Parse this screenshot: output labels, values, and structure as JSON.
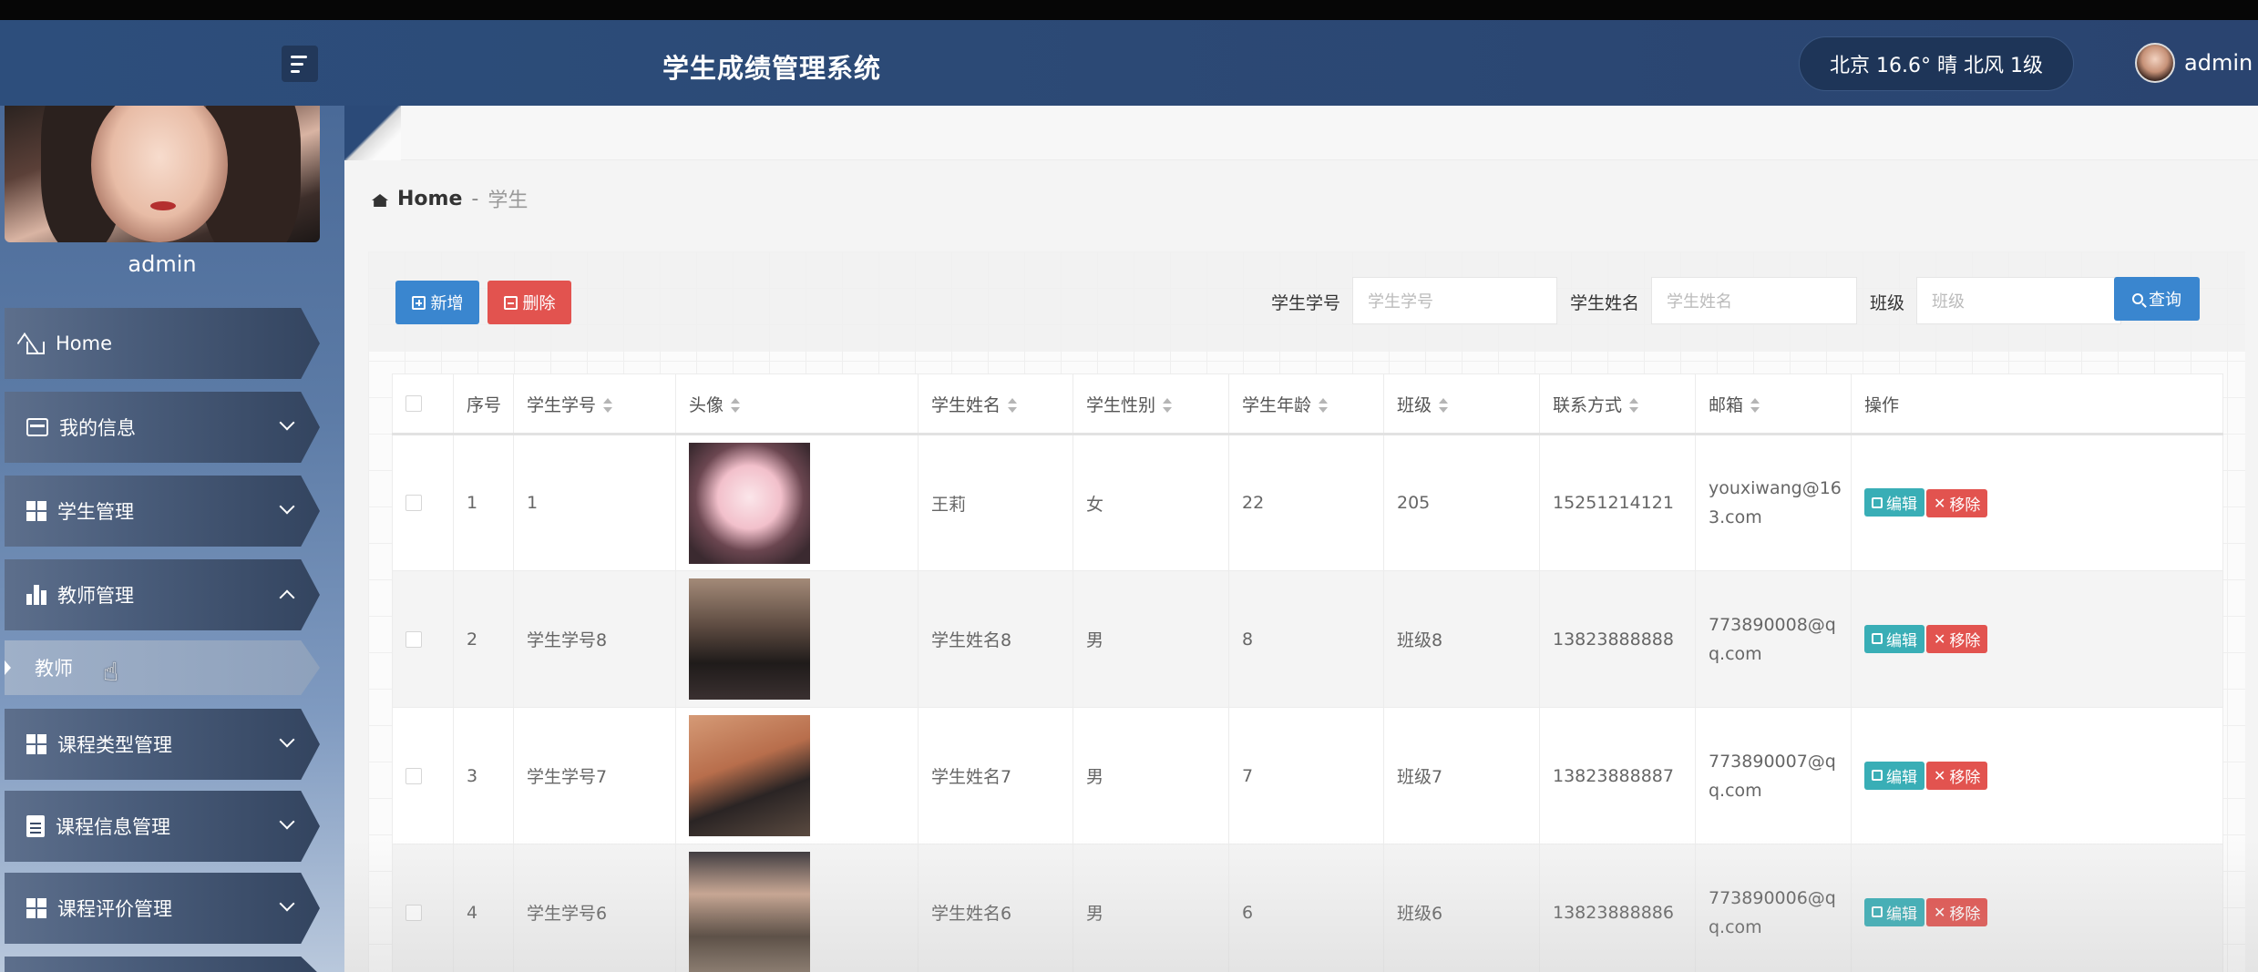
{
  "header": {
    "title": "学生成绩管理系统",
    "weather": "北京  16.6°  晴  北风  1级",
    "username": "admin"
  },
  "sidebar": {
    "profile_name": "admin",
    "items": [
      {
        "label": "Home",
        "icon": "home-icon"
      },
      {
        "label": "我的信息",
        "icon": "card-icon"
      },
      {
        "label": "学生管理",
        "icon": "grid-icon"
      },
      {
        "label": "教师管理",
        "icon": "bar-chart-icon"
      },
      {
        "label": "课程类型管理",
        "icon": "grid-icon"
      },
      {
        "label": "课程信息管理",
        "icon": "clipboard-icon"
      },
      {
        "label": "课程评价管理",
        "icon": "grid-icon"
      }
    ],
    "subitem": "教师"
  },
  "breadcrumb": {
    "home": "Home",
    "separator": "-",
    "current": "学生"
  },
  "toolbar": {
    "add_label": "新增",
    "delete_label": "删除",
    "search_label": "查询",
    "filters": [
      {
        "label": "学生学号",
        "placeholder": "学生学号"
      },
      {
        "label": "学生姓名",
        "placeholder": "学生姓名"
      },
      {
        "label": "班级",
        "placeholder": "班级"
      }
    ]
  },
  "table": {
    "headers": [
      "序号",
      "学生学号",
      "头像",
      "学生姓名",
      "学生性别",
      "学生年龄",
      "班级",
      "联系方式",
      "邮箱",
      "操作"
    ],
    "edit_label": "编辑",
    "remove_label": "移除",
    "rows": [
      {
        "index": "1",
        "sid": "1",
        "name": "王莉",
        "gender": "女",
        "age": "22",
        "class": "205",
        "phone": "15251214121",
        "email": "youxiwang@163.com"
      },
      {
        "index": "2",
        "sid": "学生学号8",
        "name": "学生姓名8",
        "gender": "男",
        "age": "8",
        "class": "班级8",
        "phone": "13823888888",
        "email": "773890008@qq.com"
      },
      {
        "index": "3",
        "sid": "学生学号7",
        "name": "学生姓名7",
        "gender": "男",
        "age": "7",
        "class": "班级7",
        "phone": "13823888887",
        "email": "773890007@qq.com"
      },
      {
        "index": "4",
        "sid": "学生学号6",
        "name": "学生姓名6",
        "gender": "男",
        "age": "6",
        "class": "班级6",
        "phone": "13823888886",
        "email": "773890006@qq.com"
      }
    ]
  }
}
